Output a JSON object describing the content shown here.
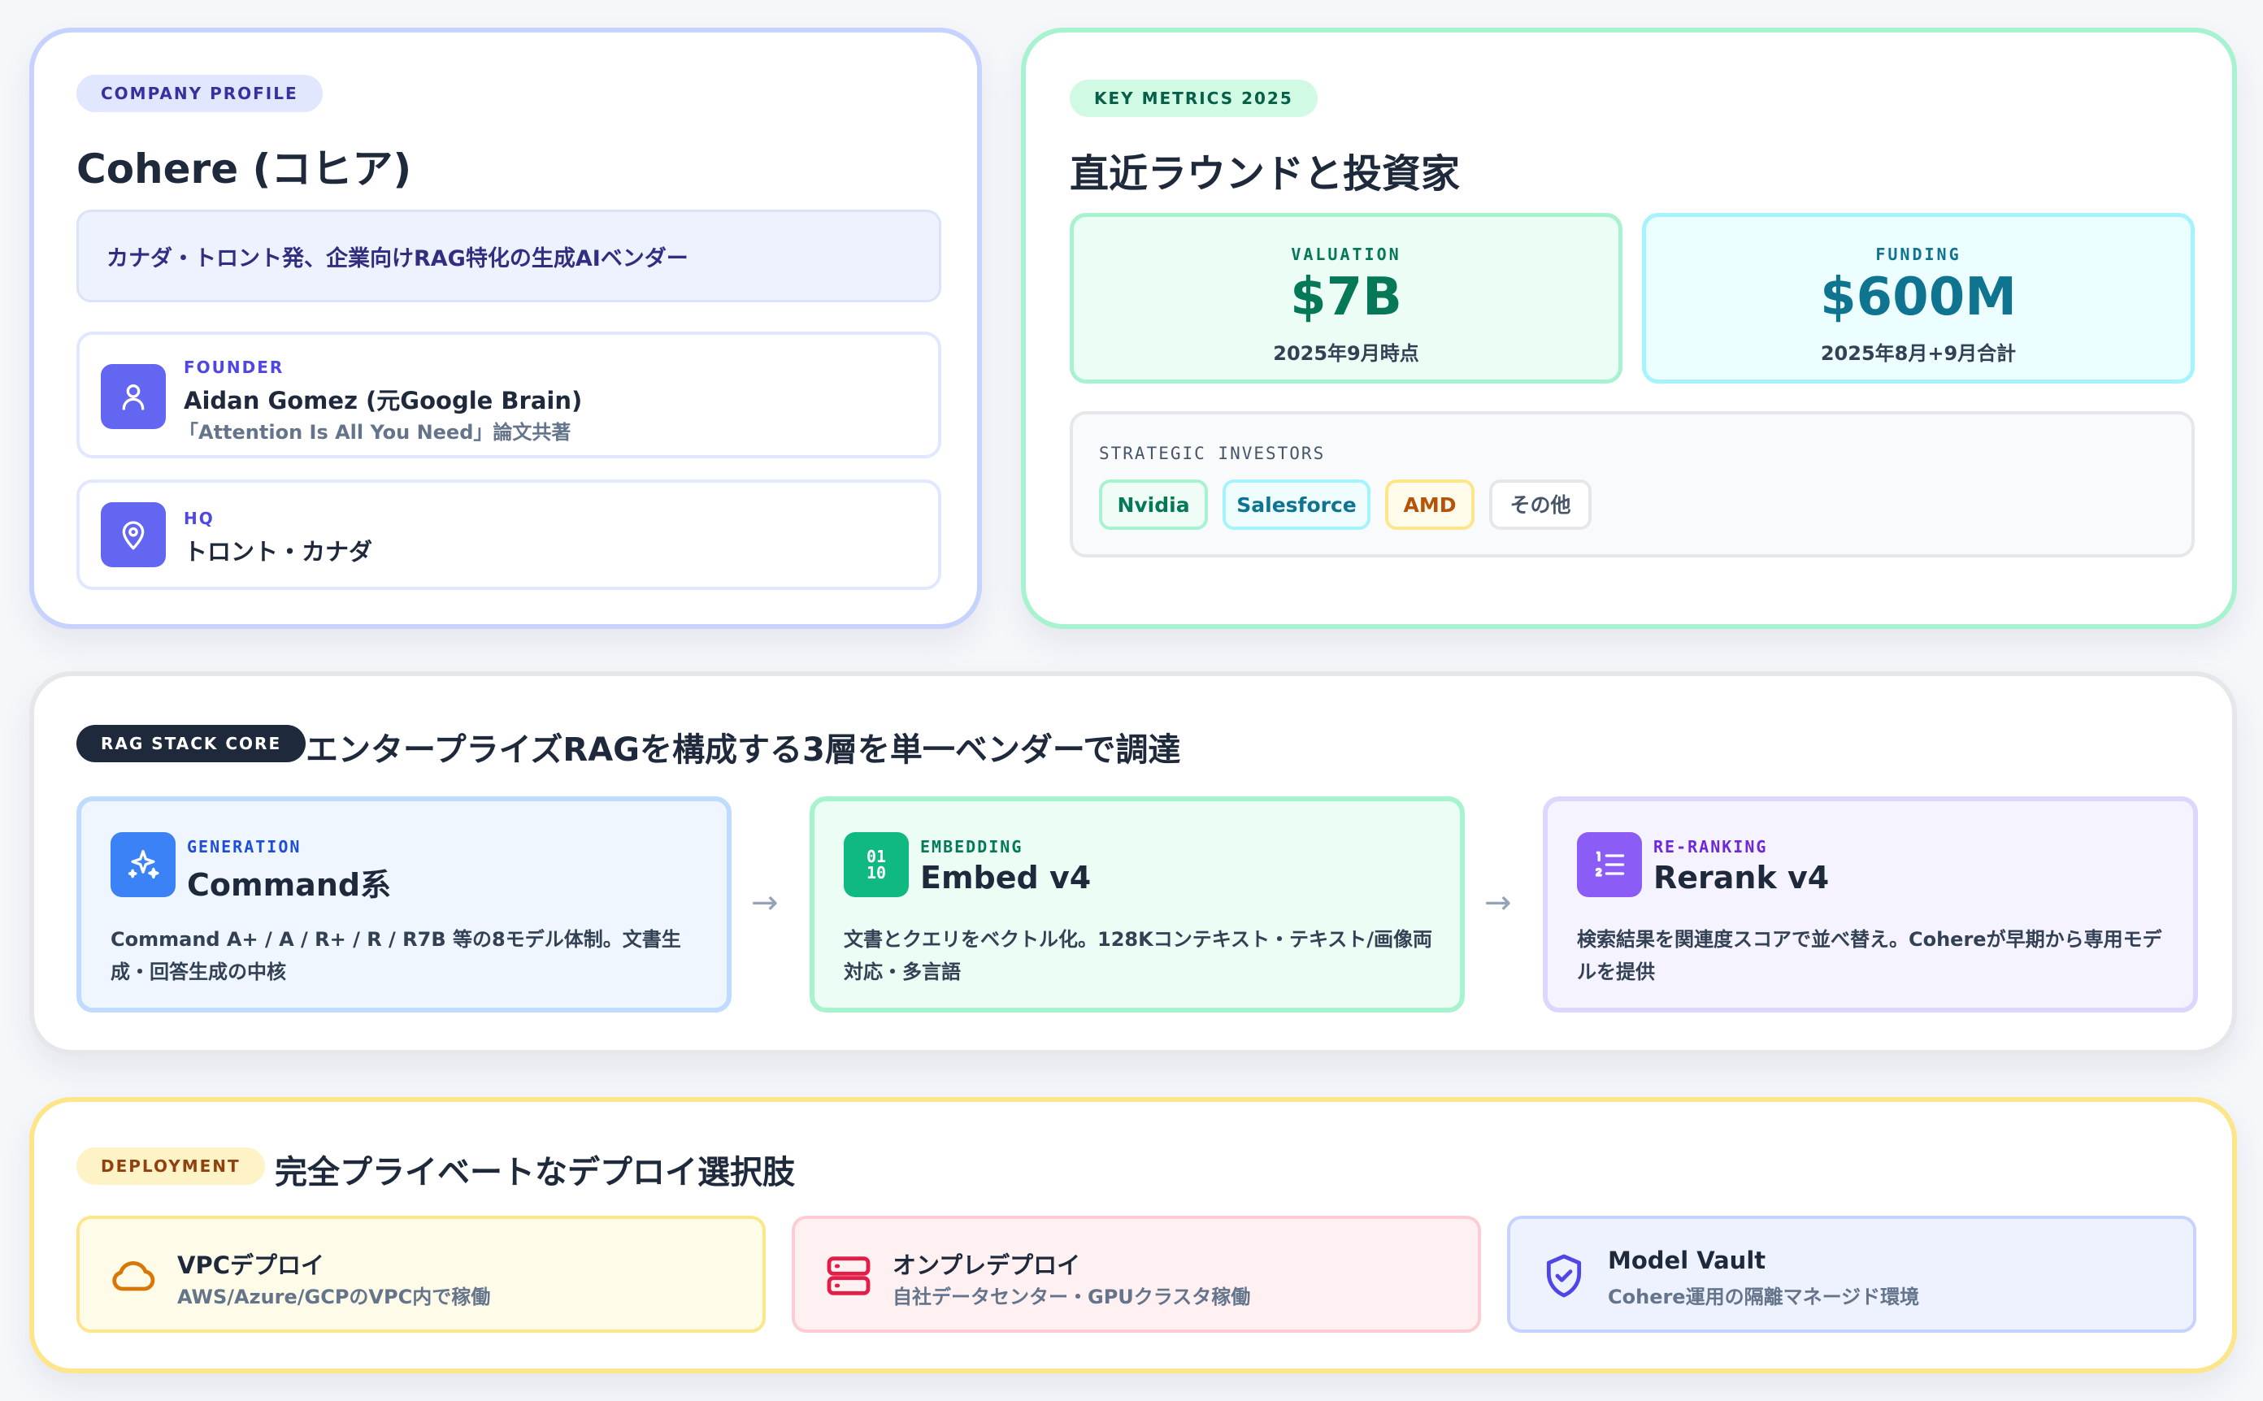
{
  "profile": {
    "badge": "COMPANY PROFILE",
    "title": "Cohere (コヒア)",
    "description": "カナダ・トロント発、企業向けRAG特化の生成AIベンダー",
    "founder": {
      "label": "FOUNDER",
      "name": "Aidan Gomez (元Google Brain)",
      "note": "「Attention Is All You Need」論文共著",
      "icon": "user-icon"
    },
    "hq": {
      "label": "HQ",
      "location": "トロント・カナダ",
      "icon": "map-pin-icon"
    }
  },
  "metrics": {
    "badge": "KEY METRICS 2025",
    "title": "直近ラウンドと投資家",
    "valuation": {
      "label": "VALUATION",
      "value": "$7B",
      "note": "2025年9月時点"
    },
    "funding": {
      "label": "FUNDING",
      "value": "$600M",
      "note": "2025年8月+9月合計"
    },
    "investors": {
      "label": "STRATEGIC INVESTORS",
      "items": [
        "Nvidia",
        "Salesforce",
        "AMD",
        "その他"
      ]
    }
  },
  "rag": {
    "badge": "RAG STACK CORE",
    "title": "エンタープライズRAGを構成する3層を単一ベンダーで調達",
    "arrow": "→",
    "layers": [
      {
        "label": "GENERATION",
        "name": "Command系",
        "desc": "Command A+ / A / R+ / R / R7B 等の8モデル体制。文書生成・回答生成の中核",
        "icon": "sparkles-icon",
        "color": "#3b82f6"
      },
      {
        "label": "EMBEDDING",
        "name": "Embed v4",
        "desc": "文書とクエリをベクトル化。128Kコンテキスト・テキスト/画像両対応・多言語",
        "icon": "binary-icon",
        "icon_text_top": "01",
        "icon_text_bottom": "10",
        "color": "#10b981"
      },
      {
        "label": "RE-RANKING",
        "name": "Rerank v4",
        "desc": "検索結果を関連度スコアで並べ替え。Cohereが早期から専用モデルを提供",
        "icon": "list-ordered-icon",
        "color": "#8b5cf6"
      }
    ]
  },
  "deployment": {
    "badge": "DEPLOYMENT",
    "title": "完全プライベートなデプロイ選択肢",
    "options": [
      {
        "name": "VPCデプロイ",
        "desc": "AWS/Azure/GCPのVPC内で稼働",
        "icon": "cloud-icon",
        "color": "#d97706"
      },
      {
        "name": "オンプレデプロイ",
        "desc": "自社データセンター・GPUクラスタ稼働",
        "icon": "server-icon",
        "color": "#e11d48"
      },
      {
        "name": "Model Vault",
        "desc": "Cohere運用の隔離マネージド環境",
        "icon": "shield-check-icon",
        "color": "#4f46e5"
      }
    ]
  }
}
